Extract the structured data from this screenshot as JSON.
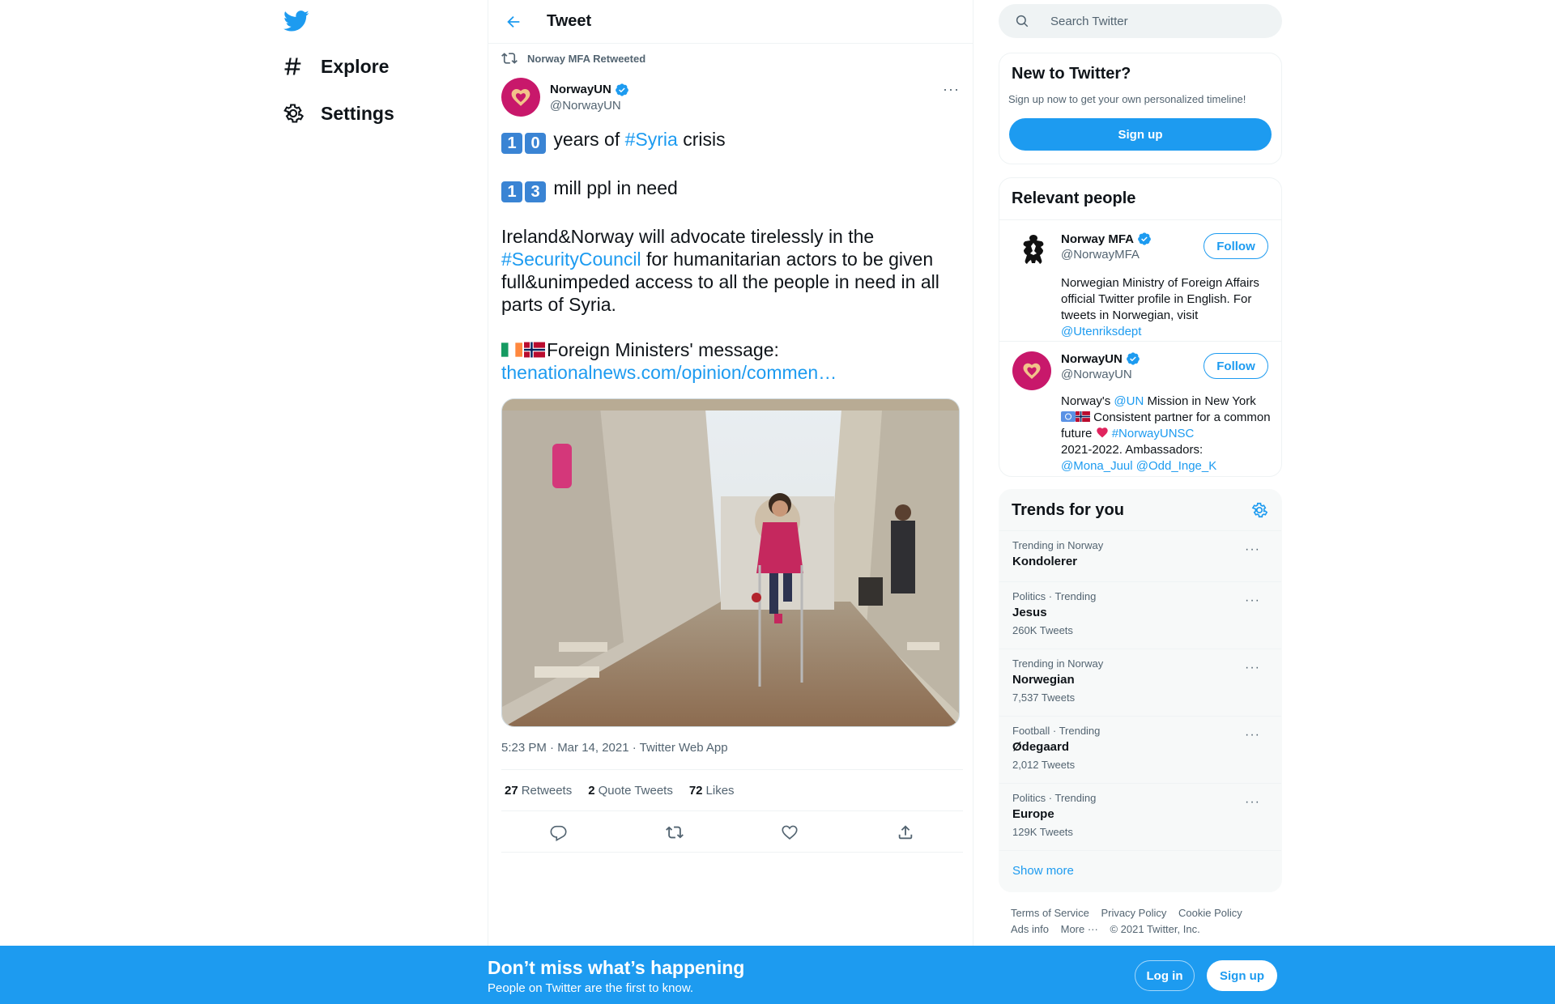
{
  "nav": {
    "explore_label": "Explore",
    "settings_label": "Settings"
  },
  "header": {
    "title": "Tweet"
  },
  "tweet": {
    "retweeted_by": "Norway MFA Retweeted",
    "author_name": "NorwayUN",
    "author_handle": "@NorwayUN",
    "line1_keycaps": [
      "1",
      "0"
    ],
    "line1_text_a": " years of ",
    "line1_hashtag": "#Syria",
    "line1_text_b": " crisis",
    "line2_keycaps": [
      "1",
      "3"
    ],
    "line2_text": " mill ppl in need",
    "para3_a": "Ireland&Norway will advocate tirelessly in the ",
    "para3_hashtag": "#SecurityCouncil",
    "para3_b": " for humanitarian actors to be given full&unimpeded access to all the people in need in all parts of Syria.",
    "para4_text": "Foreign Ministers' message:",
    "para4_link": "thenationalnews.com/opinion/commen…",
    "meta": "5:23 PM · Mar 14, 2021 · Twitter Web App",
    "stats": {
      "retweets_count": "27",
      "retweets_label": "Retweets",
      "quotes_count": "2",
      "quotes_label": "Quote Tweets",
      "likes_count": "72",
      "likes_label": "Likes"
    }
  },
  "search": {
    "placeholder": "Search Twitter"
  },
  "new_to_twitter": {
    "title": "New to Twitter?",
    "subtitle": "Sign up now to get your own personalized timeline!",
    "button": "Sign up"
  },
  "relevant_people": {
    "title": "Relevant people",
    "people": [
      {
        "name": "Norway MFA",
        "handle": "@NorwayMFA",
        "follow": "Follow",
        "bio": "Norwegian Ministry of Foreign Affairs official Twitter profile in English. For tweets in Norwegian, visit ",
        "bio_link": "@Utenriksdept"
      },
      {
        "name": "NorwayUN",
        "handle": "@NorwayUN",
        "follow": "Follow",
        "bio_a": "Norway's ",
        "bio_link1": "@UN",
        "bio_b": " Mission in New York",
        "bio_c": " Consistent partner for a common future ",
        "bio_link2": "#NorwayUNSC",
        "bio_d": "2021-2022. Ambassadors:",
        "bio_link3": "@Mona_Juul",
        "bio_link4": "@Odd_Inge_K"
      }
    ]
  },
  "trends": {
    "title": "Trends for you",
    "items": [
      {
        "category": "Trending in Norway",
        "name": "Kondolerer",
        "count": ""
      },
      {
        "category": "Politics · Trending",
        "name": "Jesus",
        "count": "260K Tweets"
      },
      {
        "category": "Trending in Norway",
        "name": "Norwegian",
        "count": "7,537 Tweets"
      },
      {
        "category": "Football · Trending",
        "name": "Ødegaard",
        "count": "2,012 Tweets"
      },
      {
        "category": "Politics · Trending",
        "name": "Europe",
        "count": "129K Tweets"
      }
    ],
    "show_more": "Show more"
  },
  "footer": {
    "terms": "Terms of Service",
    "privacy": "Privacy Policy",
    "cookie": "Cookie Policy",
    "ads": "Ads info",
    "more": "More ···",
    "copyright": "© 2021 Twitter, Inc."
  },
  "bottom_bar": {
    "title": "Don’t miss what’s happening",
    "subtitle": "People on Twitter are the first to know.",
    "login": "Log in",
    "signup": "Sign up"
  },
  "colors": {
    "accent": "#1d9bf0",
    "avatar_bg": "#c8186b",
    "text_secondary": "#536471"
  }
}
